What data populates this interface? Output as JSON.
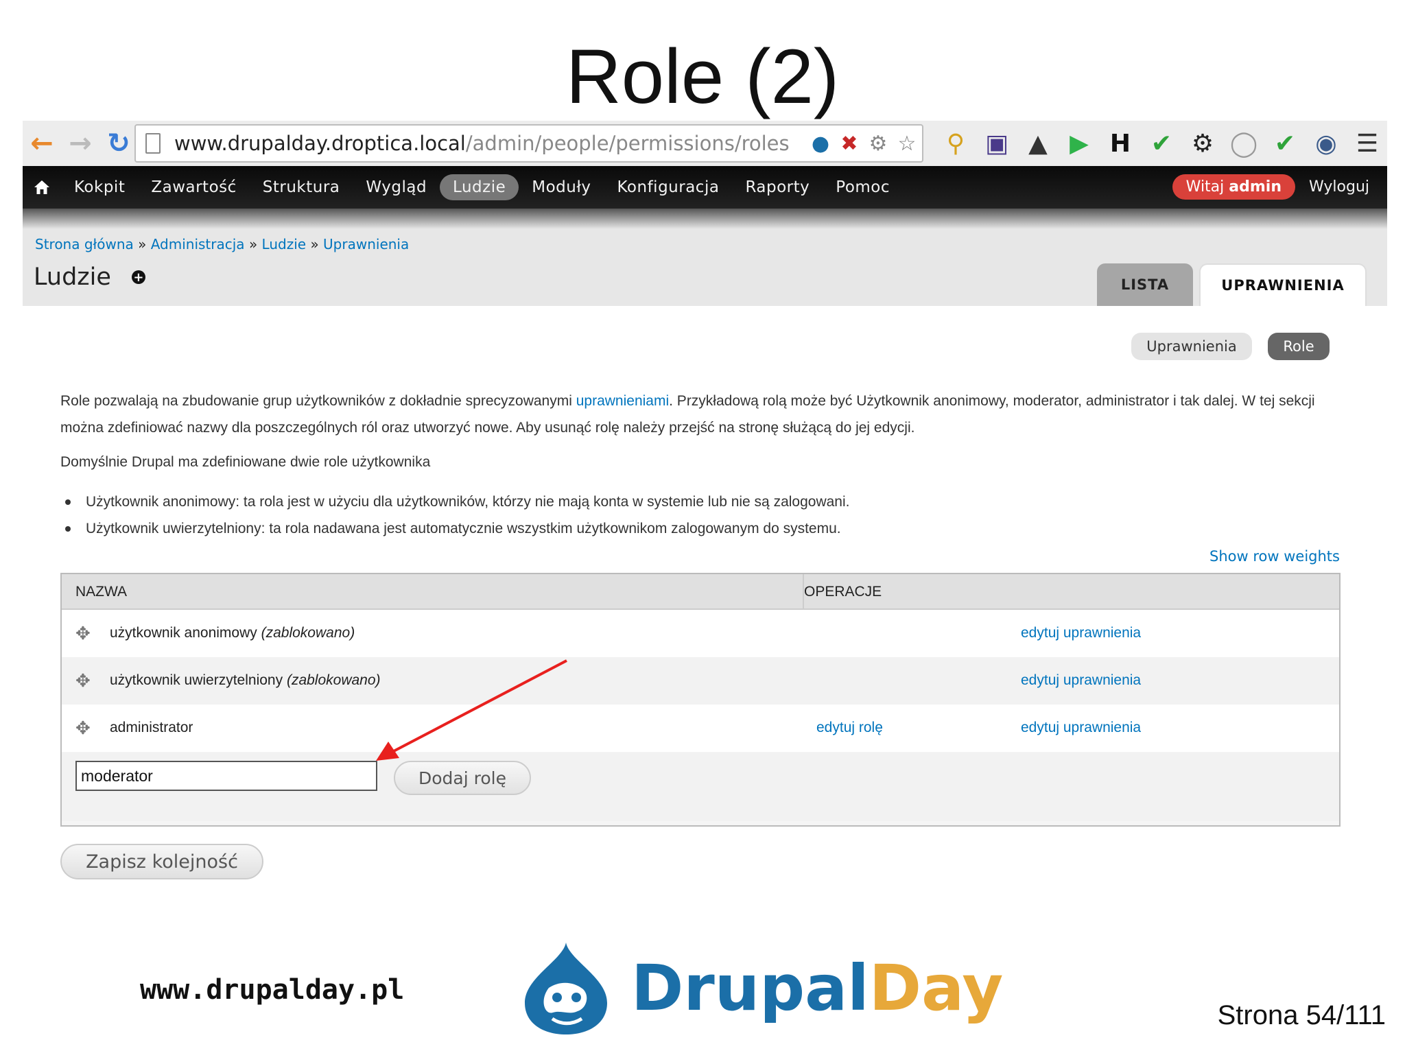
{
  "slide": {
    "title": "Role (2)",
    "footer_url": "www.drupalday.pl",
    "logo_part1": "Drupal",
    "logo_part2": "Day",
    "page_number": "Strona 54/111"
  },
  "browser": {
    "url_host": "www.drupalday.droptica.local",
    "url_path": "/admin/people/permissions/roles",
    "toolbar_icons": [
      "back-icon",
      "forward-icon",
      "reload-icon",
      "page-icon",
      "drupal-icon",
      "stop-icon",
      "gear-icon",
      "star-icon"
    ],
    "extension_icons": [
      "key-icon",
      "image-icon",
      "stamp-icon",
      "play-icon",
      "h-icon",
      "check-icon",
      "gear-icon",
      "shield-icon",
      "check-icon",
      "camera-icon",
      "menu-icon"
    ],
    "extension_h": "H"
  },
  "admin_menu": {
    "items": [
      "Kokpit",
      "Zawartość",
      "Struktura",
      "Wygląd",
      "Ludzie",
      "Moduły",
      "Konfiguracja",
      "Raporty",
      "Pomoc"
    ],
    "active": "Ludzie",
    "welcome_prefix": "Witaj",
    "welcome_user": "admin",
    "logout": "Wyloguj"
  },
  "header": {
    "breadcrumb": [
      "Strona główna",
      "Administracja",
      "Ludzie",
      "Uprawnienia"
    ],
    "breadcrumb_sep": "»",
    "title": "Ludzie",
    "tabs": [
      "LISTA",
      "UPRAWNIENIA"
    ]
  },
  "secondary_tabs": [
    "Uprawnienia",
    "Role"
  ],
  "content": {
    "intro_before_link": "Role pozwalają na zbudowanie grup użytkowników z dokładnie sprecyzowanymi ",
    "intro_link": "uprawnieniami",
    "intro_after_link": ". Przykładową rolą może być Użytkownik anonimowy, moderator, administrator i tak dalej. W tej sekcji można zdefiniować nazwy dla poszczególnych ról oraz utworzyć nowe. Aby usunąć rolę należy przejść na stronę służącą do jej edycji.",
    "default_roles_intro": "Domyślnie Drupal ma zdefiniowane dwie role użytkownika",
    "bullets": [
      "Użytkownik anonimowy: ta rola jest w użyciu dla użytkowników, którzy nie mają konta w systemie lub nie są zalogowani.",
      "Użytkownik uwierzytelniony: ta rola nadawana jest automatycznie wszystkim użytkownikom zalogowanym do systemu."
    ],
    "show_row_weights": "Show row weights"
  },
  "table": {
    "headers": [
      "NAZWA",
      "OPERACJE"
    ],
    "rows": [
      {
        "name": "użytkownik anonimowy",
        "note": "(zablokowano)",
        "edit_role": "",
        "edit_perms": "edytuj uprawnienia"
      },
      {
        "name": "użytkownik uwierzytelniony",
        "note": "(zablokowano)",
        "edit_role": "",
        "edit_perms": "edytuj uprawnienia"
      },
      {
        "name": "administrator",
        "note": "",
        "edit_role": "edytuj rolę",
        "edit_perms": "edytuj uprawnienia"
      }
    ],
    "new_role_value": "moderator",
    "add_role_button": "Dodaj rolę"
  },
  "save_order_button": "Zapisz kolejność",
  "colors": {
    "link": "#0074bd",
    "welcome_badge": "#d9413a",
    "arrow": "#e8201e",
    "logo_blue": "#1b6fa8",
    "logo_orange": "#e7a83a"
  }
}
